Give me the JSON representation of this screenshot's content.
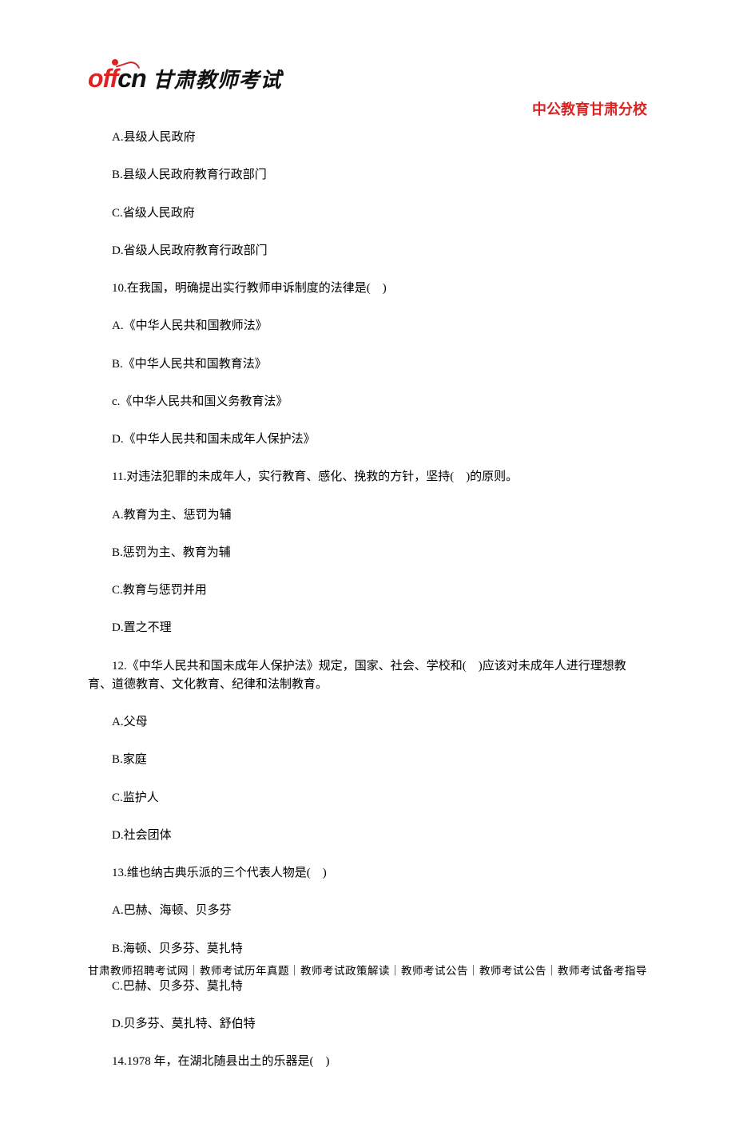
{
  "logo": {
    "brand_red": "off",
    "brand_black": "cn",
    "brand_cn": "甘肃教师考试"
  },
  "header": {
    "subtitle": "中公教育甘肃分校"
  },
  "lines": {
    "l1": "A.县级人民政府",
    "l2": "B.县级人民政府教育行政部门",
    "l3": "C.省级人民政府",
    "l4": "D.省级人民政府教育行政部门",
    "l5": "10.在我国，明确提出实行教师申诉制度的法律是(　)",
    "l6": "A.《中华人民共和国教师法》",
    "l7": "B.《中华人民共和国教育法》",
    "l8": "c.《中华人民共和国义务教育法》",
    "l9": "D.《中华人民共和国未成年人保护法》",
    "l10": "11.对违法犯罪的未成年人，实行教育、感化、挽救的方针，坚持(　)的原则。",
    "l11": "A.教育为主、惩罚为辅",
    "l12": "B.惩罚为主、教育为辅",
    "l13": "C.教育与惩罚并用",
    "l14": "D.置之不理",
    "l15": "12.《中华人民共和国未成年人保护法》规定，国家、社会、学校和(　)应该对未成年人进行理想教育、道德教育、文化教育、纪律和法制教育。",
    "l16": "A.父母",
    "l17": "B.家庭",
    "l18": "C.监护人",
    "l19": "D.社会团体",
    "l20": "13.维也纳古典乐派的三个代表人物是(　)",
    "l21": "A.巴赫、海顿、贝多芬",
    "l22": "B.海顿、贝多芬、莫扎特",
    "l23": "C.巴赫、贝多芬、莫扎特",
    "l24": "D.贝多芬、莫扎特、舒伯特",
    "l25": "14.1978 年，在湖北随县出土的乐器是(　)"
  },
  "footer": {
    "text": "甘肃教师招聘考试网｜教师考试历年真题｜教师考试政策解读｜教师考试公告｜教师考试公告｜教师考试备考指导"
  }
}
